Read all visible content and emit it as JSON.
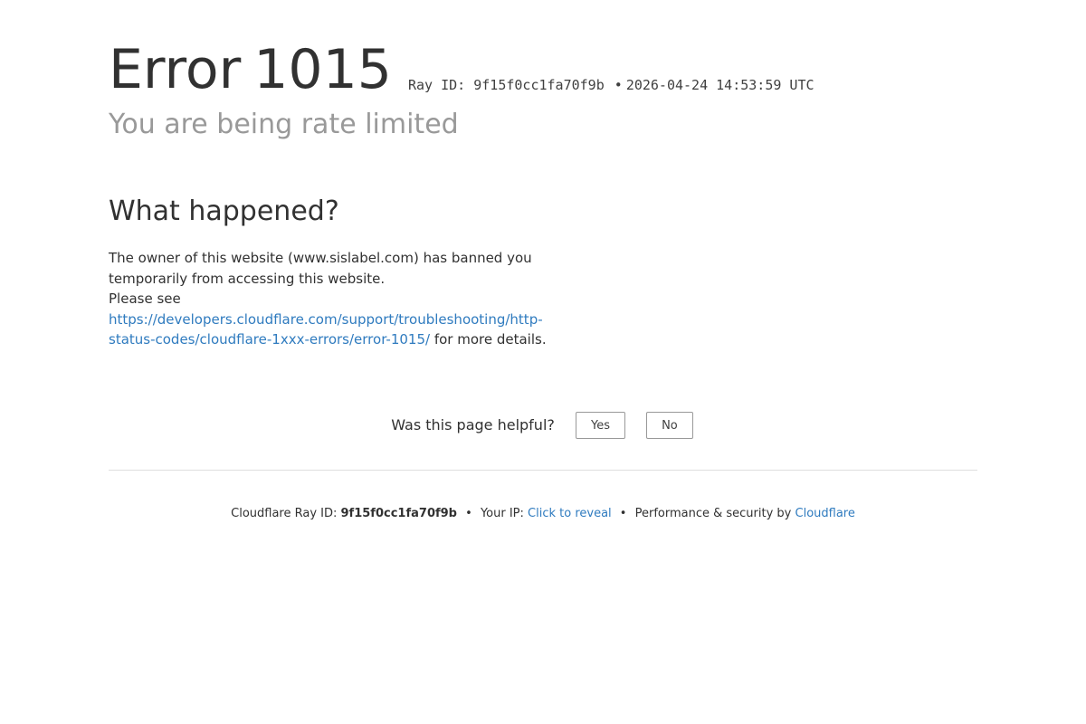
{
  "header": {
    "error_word": "Error",
    "error_code": "1015",
    "ray_label": "Ray ID: 9f15f0cc1fa70f9b",
    "ray_separator": "•",
    "timestamp": "2026-04-24 14:53:59 UTC",
    "subtitle": "You are being rate limited"
  },
  "what_happened": {
    "heading": "What happened?",
    "line1": "The owner of this website (www.sislabel.com) has banned you temporarily from accessing this website.",
    "please_see": "Please see",
    "link_text": "https://developers.cloudflare.com/support/troubleshooting/http-status-codes/cloudflare-1xxx-errors/error-1015/",
    "after_link": " for more details."
  },
  "feedback": {
    "question": "Was this page helpful?",
    "yes_label": "Yes",
    "no_label": "No"
  },
  "footer": {
    "ray_prefix": "Cloudflare Ray ID:",
    "ray_id": "9f15f0cc1fa70f9b",
    "separator": "•",
    "ip_prefix": "Your IP:",
    "ip_link": "Click to reveal",
    "perf_prefix": "Performance & security by",
    "brand_link": "Cloudflare"
  },
  "colors": {
    "link": "#2f7bbf",
    "text": "#313131",
    "muted": "#999999"
  }
}
